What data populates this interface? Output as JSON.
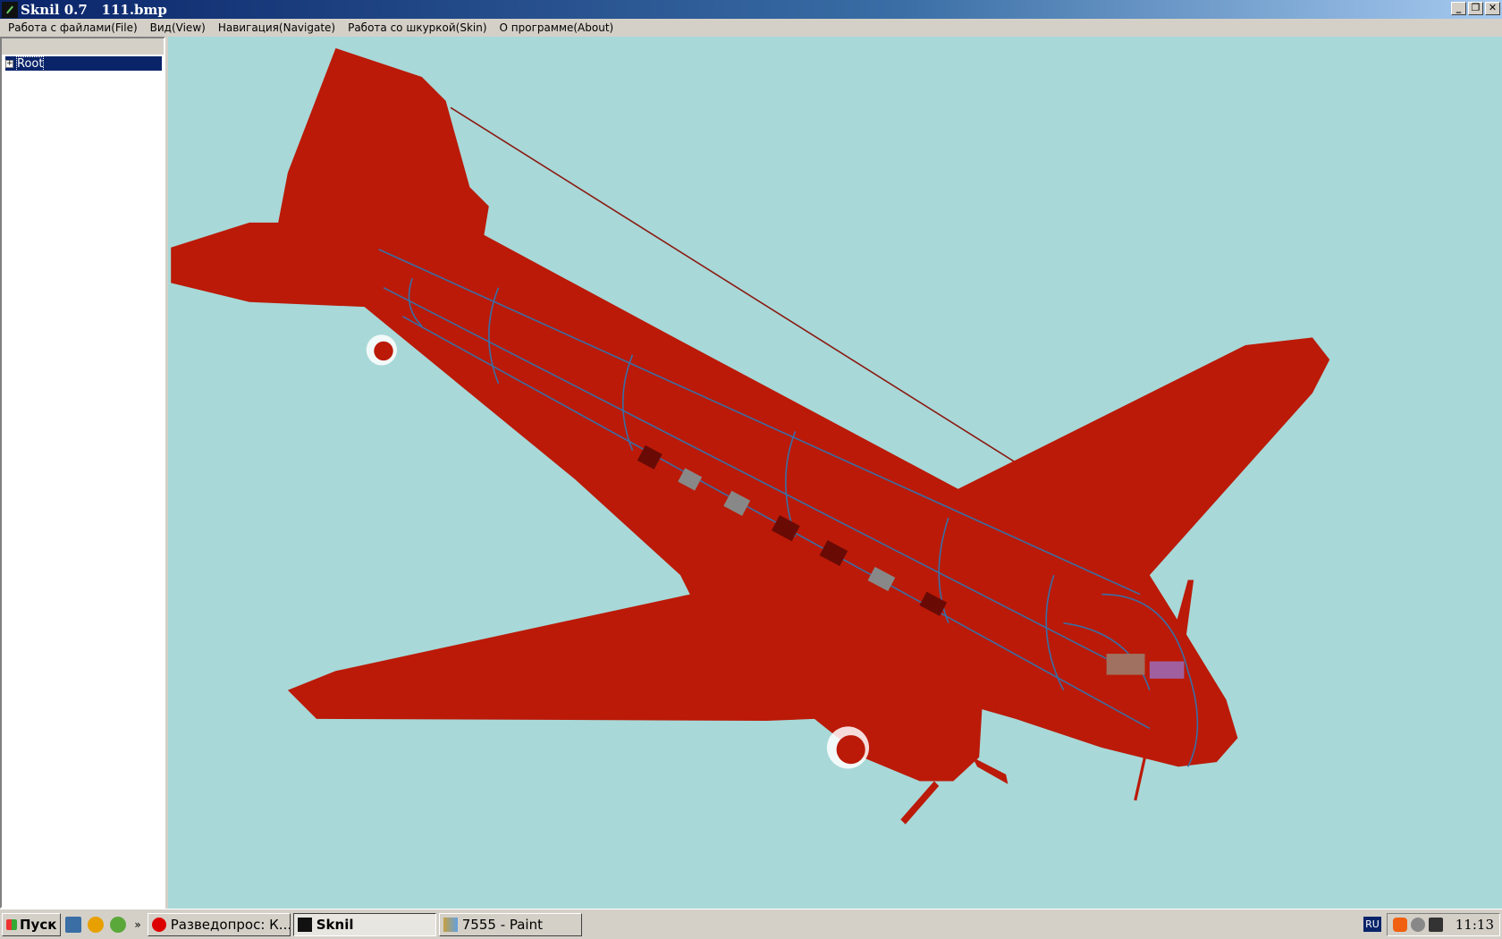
{
  "window": {
    "title": "Sknil 0.7   111.bmp",
    "controls": [
      "_",
      "❐",
      "✕"
    ]
  },
  "menu": [
    "Работа с файлами(File)",
    "Вид(View)",
    "Навигация(Navigate)",
    "Работа со шкуркой(Skin)",
    "О программе(About)"
  ],
  "tree": {
    "expand": "+",
    "root": "Root"
  },
  "colors": {
    "viewport_bg": "#a8d8d8",
    "model": "#bb1a08",
    "panel_lines": "#3a6ea5"
  },
  "taskbar": {
    "start": "Пуск",
    "more": "»",
    "tasks": [
      {
        "label": "Разведопрос: К...",
        "icon": "opera-icon"
      },
      {
        "label": "Sknil",
        "icon": "sknil-icon",
        "active": true
      },
      {
        "label": "7555 - Paint",
        "icon": "paint-icon"
      }
    ],
    "lang": "RU",
    "clock": "11:13"
  }
}
